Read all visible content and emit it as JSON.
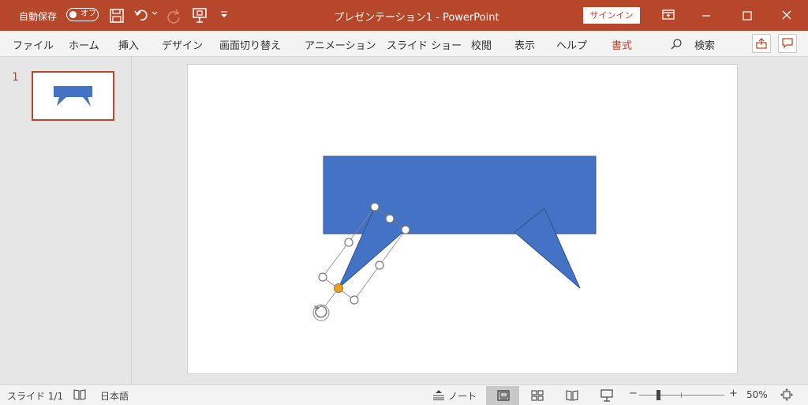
{
  "titlebar": {
    "autosave_label": "自動保存",
    "autosave_state": "オフ",
    "document_title": "プレゼンテーション1  -  PowerPoint",
    "signin_label": "サインイン"
  },
  "ribbon": {
    "tabs": [
      "ファイル",
      "ホーム",
      "挿入",
      "デザイン",
      "画面切り替え",
      "アニメーション",
      "スライド ショー",
      "校閲",
      "表示",
      "ヘルプ",
      "書式"
    ],
    "active_tab": "書式",
    "search_label": "検索"
  },
  "thumbnails": {
    "slide_number": "1"
  },
  "statusbar": {
    "slide_indicator": "スライド 1/1",
    "language": "日本語",
    "notes_label": "ノート",
    "zoom_level": "50%",
    "zoom_minus": "−",
    "zoom_plus": "+",
    "zoom_slider_fraction": 0.2
  },
  "colors": {
    "accent": "#b7472a",
    "active_tab": "#c43e1c",
    "shape_fill": "#4472c4",
    "shape_border": "#2f528f",
    "handle_adjust": "#f0a30a"
  },
  "icons": {
    "save": "save-icon",
    "undo": "undo-icon",
    "redo": "redo-icon",
    "present": "present-icon",
    "customize": "chevron-down-icon",
    "ribbon_display": "ribbon-display-icon",
    "minimize": "minimize-icon",
    "maximize": "maximize-icon",
    "close": "close-icon",
    "search": "search-icon",
    "share": "share-icon",
    "comments": "comment-icon",
    "rotate": "rotate-icon",
    "accessibility": "accessibility-icon",
    "notes": "notes-icon",
    "view_normal": "view-normal-icon",
    "view_sorter": "view-sorter-icon",
    "view_reading": "view-reading-icon",
    "view_slideshow": "view-slideshow-icon",
    "fit_window": "fit-window-icon"
  }
}
